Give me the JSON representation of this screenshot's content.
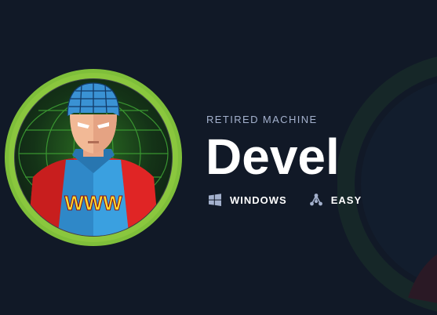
{
  "machine": {
    "status": "RETIRED MACHINE",
    "name": "Devel",
    "os": {
      "label": "WINDOWS",
      "icon": "windows-icon"
    },
    "difficulty": {
      "label": "EASY",
      "icon": "difficulty-icon"
    },
    "avatar": {
      "icon": "devel-avatar",
      "shirt_text": "WWW"
    }
  },
  "colors": {
    "background": "#111927",
    "ring": "#8ac73e",
    "eyebrow": "#a4b1cd",
    "title": "#ffffff"
  }
}
